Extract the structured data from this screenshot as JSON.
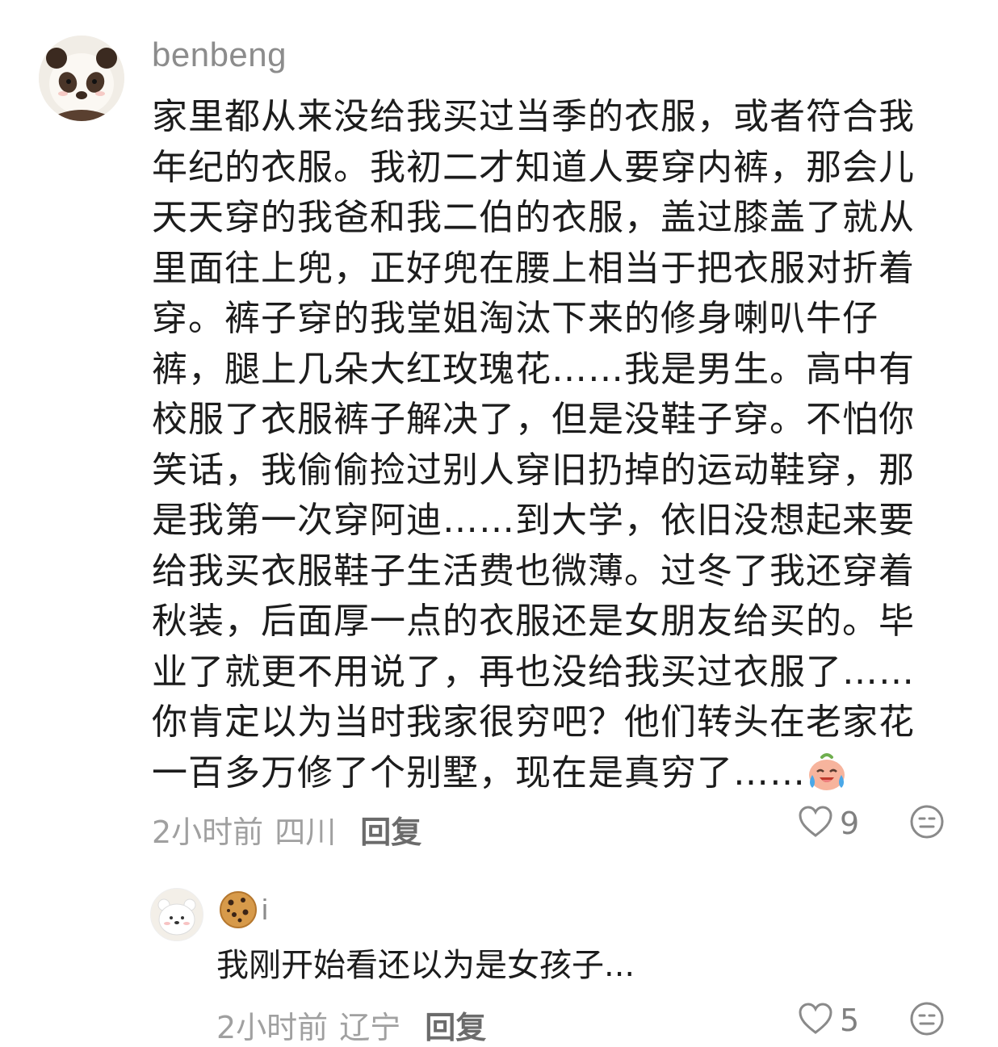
{
  "main_comment": {
    "avatar_icon": "panda-avatar-icon",
    "username": "benbeng",
    "text_lines": [
      "家里都从来没给我买过当季的衣服，或者符合我",
      "年纪的衣服。我初二才知道人要穿内裤，那会儿",
      "天天穿的我爸和我二伯的衣服，盖过膝盖了就从",
      "里面往上兜，正好兜在腰上相当于把衣服对折着",
      "穿。裤子穿的我堂姐淘汰下来的修身喇叭牛仔",
      "裤，腿上几朵大红玫瑰花……我是男生。高中有",
      "校服了衣服裤子解决了，但是没鞋子穿。不怕你",
      "笑话，我偷偷捡过别人穿旧扔掉的运动鞋穿，那",
      "是我第一次穿阿迪……到大学，依旧没想起来要",
      "给我买衣服鞋子生活费也微薄。过冬了我还穿着",
      "秋装，后面厚一点的衣服还是女朋友给买的。毕",
      "业了就更不用说了，再也没给我买过衣服了……",
      "你肯定以为当时我家很穷吧？他们转头在老家花",
      "一百多万修了个别墅，现在是真穷了……"
    ],
    "inline_emoji": "crying-laughing-emoji-icon",
    "time": "2小时前",
    "location": "四川",
    "reply_label": "回复",
    "like_count": "9",
    "icons": {
      "like": "heart-outline-icon",
      "react": "neutral-face-icon"
    }
  },
  "reply_comment": {
    "avatar_icon": "white-bear-avatar-icon",
    "username_icon": "cookie-icon",
    "username": "i",
    "text": "我刚开始看还以为是女孩子...",
    "time": "2小时前",
    "location": "辽宁",
    "reply_label": "回复",
    "like_count": "5",
    "icons": {
      "like": "heart-outline-icon",
      "react": "neutral-face-icon"
    }
  },
  "colors": {
    "text": "#1c1c1c",
    "meta": "#a0a0a0",
    "username": "#8c8c8c",
    "background": "#ffffff"
  }
}
